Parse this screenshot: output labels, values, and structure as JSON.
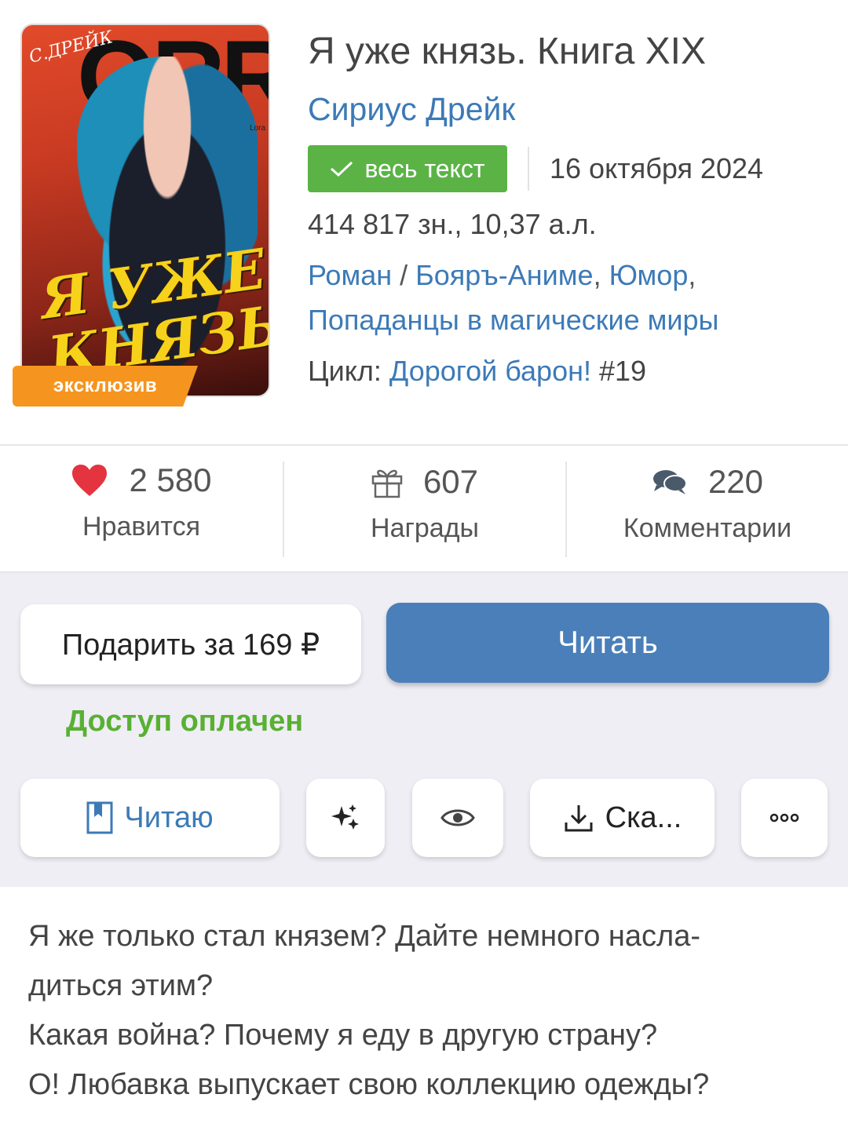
{
  "cover": {
    "author_text": "С.ДРЕЙК",
    "corner_text": "Lora",
    "title_lines": [
      "Я УЖЕ",
      "КНЯЗЬ"
    ],
    "badge": "эксклюзив"
  },
  "book": {
    "title": "Я уже князь. Книга XIX",
    "author": "Сириус Дрейк",
    "status_badge": "весь текст",
    "date": "16 октября 2024",
    "size": "414 817 зн., 10,37 а.л.",
    "genre_main": "Роман",
    "genre_sep": " / ",
    "genres": [
      "Бояръ-Аниме",
      "Юмор",
      "Попаданцы в магические миры"
    ],
    "cycle_label": "Цикл: ",
    "cycle_name": "Дорогой барон!",
    "cycle_number": " #19"
  },
  "stats": {
    "likes_count": "2 580",
    "likes_label": "Нравится",
    "rewards_count": "607",
    "rewards_label": "Награды",
    "comments_count": "220",
    "comments_label": "Комментарии"
  },
  "actions": {
    "gift_label": "Подарить за 169 ₽",
    "read_label": "Читать",
    "paid_status": "Доступ оплачен",
    "reading_label": "Читаю",
    "download_label": "Ска..."
  },
  "description": {
    "line1": "Я же только стал князем? Дайте немного насла-",
    "line2": "диться этим?",
    "line3": "Какая война? Почему я еду в другую страну?",
    "line4": "О! Любавка выпускает свою коллекцию одежды?"
  },
  "colors": {
    "link": "#3c7ab7",
    "badge_green": "#5bb346",
    "exclusive_orange": "#f5951f",
    "read_button": "#4a7fb9",
    "paid_green": "#59b033",
    "heart": "#e3343f"
  },
  "icons": [
    "check-icon",
    "heart-icon",
    "gift-icon",
    "comments-icon",
    "bookmark-icon",
    "sparkle-icon",
    "eye-icon",
    "download-icon",
    "more-icon"
  ]
}
